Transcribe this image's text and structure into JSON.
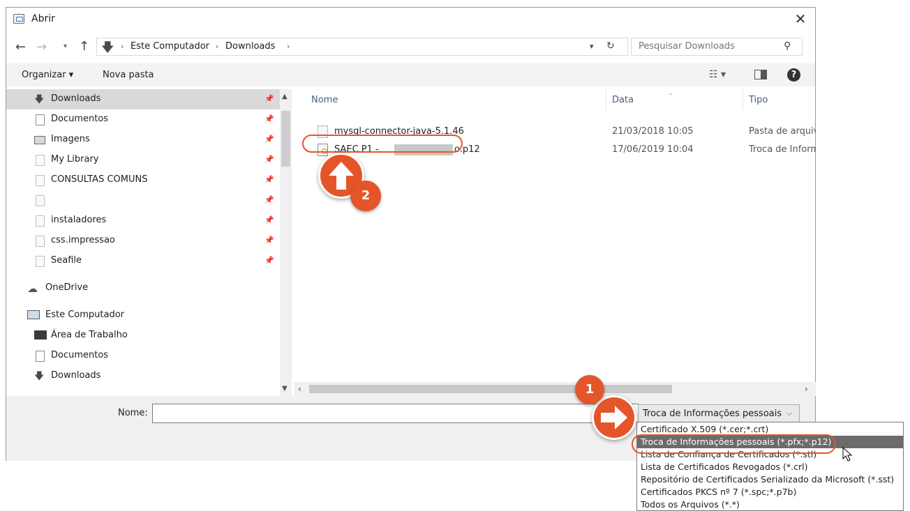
{
  "window": {
    "title": "Abrir",
    "close_glyph": "✕"
  },
  "address": {
    "breadcrumbs": [
      "Este Computador",
      "Downloads"
    ],
    "search_placeholder": "Pesquisar Downloads"
  },
  "toolbar": {
    "organize_label": "Organizar ▾",
    "new_folder_label": "Nova pasta"
  },
  "nav_pane": {
    "items": [
      {
        "label": "Downloads",
        "icon": "download-arrow-icon",
        "pinned": true,
        "selected": true
      },
      {
        "label": "Documentos",
        "icon": "document-icon",
        "pinned": true
      },
      {
        "label": "Imagens",
        "icon": "image-icon",
        "pinned": true
      },
      {
        "label": "My Library",
        "icon": "library-icon",
        "pinned": true
      },
      {
        "label": "CONSULTAS COMUNS",
        "icon": "folder-icon",
        "pinned": true
      },
      {
        "label": "",
        "icon": "folder-icon",
        "pinned": true
      },
      {
        "label": "instaladores",
        "icon": "network-folder-icon",
        "pinned": true
      },
      {
        "label": "css.impressao",
        "icon": "network-folder-icon",
        "pinned": true
      },
      {
        "label": "Seafile",
        "icon": "folder-icon",
        "pinned": true
      },
      {
        "label": "OneDrive",
        "icon": "cloud-icon"
      },
      {
        "label": "Este Computador",
        "icon": "computer-icon"
      },
      {
        "label": "Área de Trabalho",
        "icon": "desktop-icon"
      },
      {
        "label": "Documentos",
        "icon": "document-icon"
      },
      {
        "label": "Downloads",
        "icon": "download-arrow-icon"
      }
    ]
  },
  "file_list": {
    "columns": [
      "Nome",
      "Data",
      "Tipo"
    ],
    "rows": [
      {
        "name": "mysql-connector-java-5.1.46",
        "date": "21/03/2018 10:05",
        "type": "Pasta de arquivos"
      },
      {
        "name": "SAEC P1 -",
        "name_suffix": "o.p12",
        "date": "17/06/2019 10:04",
        "type": "Troca de Informações pessoais"
      }
    ]
  },
  "bottom": {
    "name_label": "Nome:",
    "name_value": "",
    "filter_value": "Troca de Informações pessoais"
  },
  "filter_options": [
    "Certificado X.509 (*.cer;*.crt)",
    "Troca de Informações pessoais (*.pfx;*.p12)",
    "Lista de Confiança de Certificados (*.stl)",
    "Lista de Certificados Revogados (*.crl)",
    "Repositório de Certificados Serializado da Microsoft (*.sst)",
    "Certificados PKCS nº 7 (*.spc;*.p7b)",
    "Todos os Arquivos (*.*)"
  ],
  "annotations": {
    "step_1": "1",
    "step_2": "2",
    "accent_color": "#e4562a"
  }
}
